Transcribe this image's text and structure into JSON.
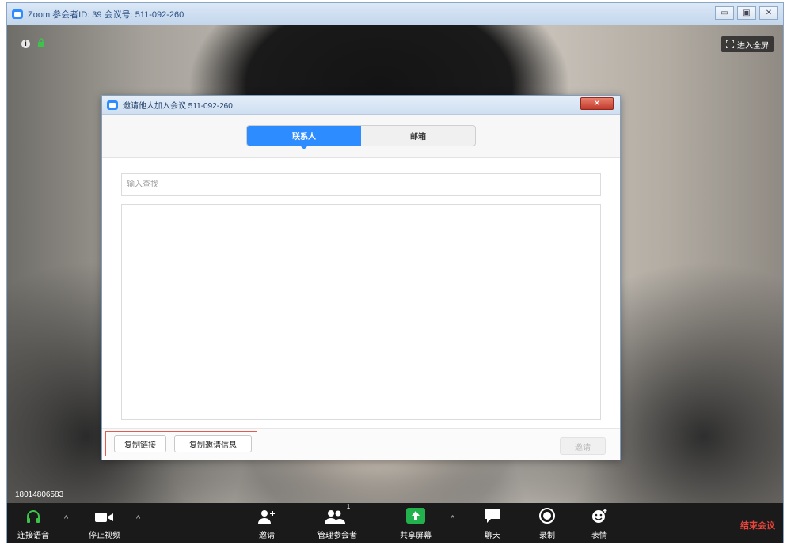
{
  "window": {
    "title": "Zoom 参会者ID: 39   会议号: 511-092-260",
    "buttons": [
      "▭",
      "▣",
      "✕"
    ]
  },
  "video": {
    "fullscreen_label": "进入全屏",
    "participant_name": "18014806583"
  },
  "dialog": {
    "title": "邀请他人加入会议 511-092-260",
    "close_label": "✕",
    "tabs": [
      {
        "label": "联系人",
        "active": true
      },
      {
        "label": "邮箱",
        "active": false
      }
    ],
    "search_placeholder": "输入查找",
    "copy_link_label": "复制链接",
    "copy_invite_label": "复制邀请信息",
    "invite_label": "邀请"
  },
  "toolbar": {
    "join_audio": "连接语音",
    "stop_video": "停止视频",
    "invite": "邀请",
    "manage_participants": "管理参会者",
    "participant_count": "1",
    "share_screen": "共享屏幕",
    "chat": "聊天",
    "record": "录制",
    "reactions": "表情",
    "end_meeting": "结束会议"
  },
  "colors": {
    "accent": "#2d8cff",
    "end": "#e8453c",
    "share_green": "#22b14c",
    "highlight_border": "#e35b4f"
  }
}
